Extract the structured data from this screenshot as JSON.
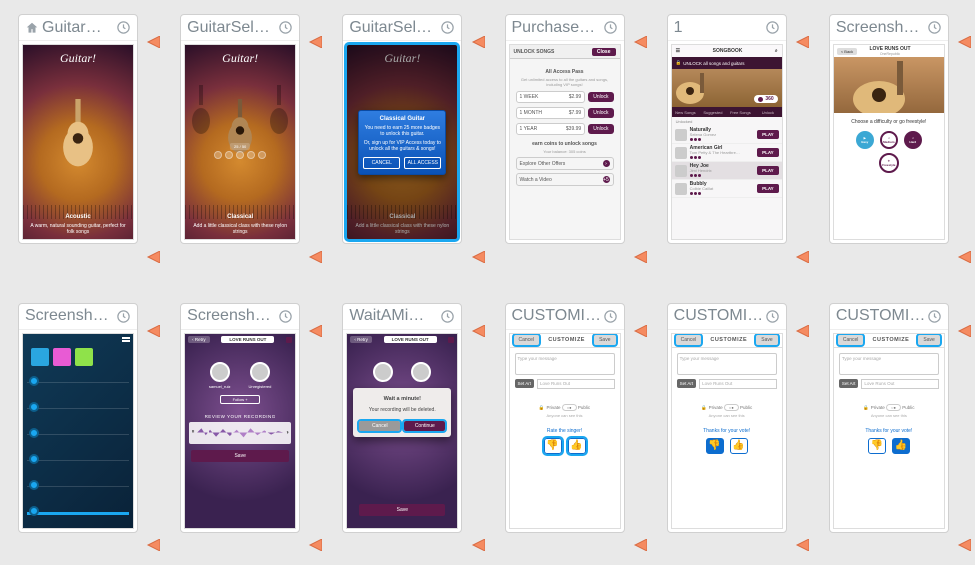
{
  "cards": [
    {
      "title": "Guitar…",
      "home": true
    },
    {
      "title": "GuitarSel…"
    },
    {
      "title": "GuitarSel…",
      "selected": true
    },
    {
      "title": "Purchase…"
    },
    {
      "title": "1"
    },
    {
      "title": "Screensh…"
    },
    {
      "title": "Screensh…"
    },
    {
      "title": "Screensh…"
    },
    {
      "title": "WaitAMi…"
    },
    {
      "title": "CUSTOMI…"
    },
    {
      "title": "CUSTOMI…"
    },
    {
      "title": "CUSTOMI…"
    }
  ],
  "guitar1": {
    "logo": "Guitar!",
    "name": "Acoustic",
    "desc": "A warm, natural sounding guitar, perfect for folk songs"
  },
  "guitar2": {
    "logo": "Guitar!",
    "name": "Classical",
    "desc": "Add a little classical class with these nylon strings",
    "progress": "25 / 50"
  },
  "guitar3": {
    "logo": "Guitar!",
    "name": "Classical",
    "desc": "Add a little classical class with these nylon strings",
    "dialog_title": "Classical Guitar",
    "dialog_line1": "You need to earn 25 more badges to unlock this guitar.",
    "dialog_line2": "Or, sign up for VIP Access today to unlock all the guitars & songs!",
    "btn_cancel": "CANCEL",
    "btn_all": "ALL ACCESS"
  },
  "purchase": {
    "header": "UNLOCK SONGS",
    "close": "Close",
    "pass_title": "All Access Pass",
    "pass_sub": "Get unlimited access to all the guitars and songs, including VIP songs!",
    "iap": [
      {
        "period": "1 WEEK",
        "price": "$2.99"
      },
      {
        "period": "1 MONTH",
        "price": "$7.99"
      },
      {
        "period": "1 YEAR",
        "price": "$39.99"
      }
    ],
    "unlock_btn": "Unlock",
    "coins_head": "earn coins to unlock songs",
    "balance": "Your balance: 305 coins",
    "explore": "Explore Other Offers",
    "watch": "Watch a Video",
    "watch_val": "+5"
  },
  "songbook": {
    "title": "SONGBOOK",
    "banner": "UNLOCK all songs and guitars",
    "coins": "360",
    "tabs": [
      "New Songs",
      "Suggested",
      "Free Songs",
      "Unlock"
    ],
    "section": "Unlocked",
    "songs": [
      {
        "t": "Naturally",
        "a": "Selena Gomez"
      },
      {
        "t": "American Girl",
        "a": "Tom Petty & The Heartbre…"
      },
      {
        "t": "Hey Joe",
        "a": "Jimi Hendrix"
      },
      {
        "t": "Bubbly",
        "a": "Colbie Caillat"
      }
    ],
    "play": "PLAY"
  },
  "difficulty": {
    "back": "< Back",
    "song": "LOVE RUNS OUT",
    "artist": "OneRepublic",
    "prompt": "Choose a difficulty or go freestyle!",
    "easy": "Easy",
    "medium": "Medium",
    "hard": "Hard",
    "free": "Freestyle"
  },
  "review": {
    "retry": "Retry",
    "title": "LOVE RUNS OUT",
    "user1": "samuel_ruiz",
    "user2": "Unregistered",
    "follow": "Follow  +",
    "label": "REVIEW YOUR RECORDING",
    "save": "Save"
  },
  "wait": {
    "retry": "Retry",
    "title": "LOVE RUNS OUT",
    "heading": "Wait a minute!",
    "body": "Your recording will be deleted.",
    "cancel": "Cancel",
    "cont": "Continue",
    "save": "Save"
  },
  "customize": {
    "cancel": "Cancel",
    "title": "CUSTOMIZE",
    "save": "Save",
    "placeholder": "Type your message",
    "setart": "Set Art",
    "song": "Love Runs Out",
    "private": "Private",
    "public": "Public",
    "anyone": "Anyone can see this",
    "rate": "Rate the singer!",
    "thanks": "Thanks for your vote!"
  }
}
